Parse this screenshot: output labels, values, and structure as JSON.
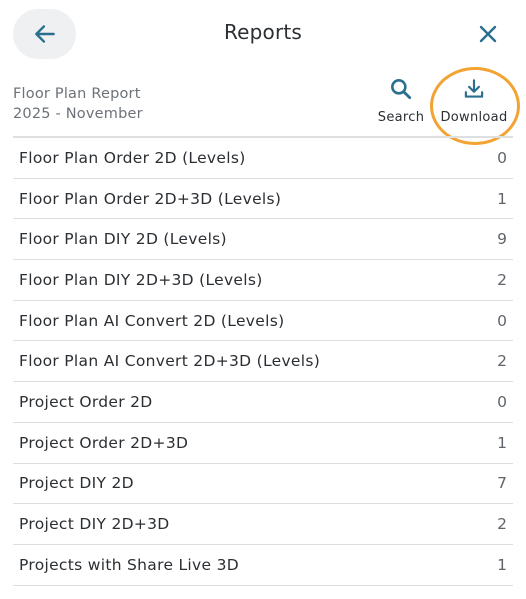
{
  "header": {
    "title": "Reports"
  },
  "report": {
    "name": "Floor Plan Report",
    "period": "2025 - November"
  },
  "actions": {
    "search_label": "Search",
    "download_label": "Download"
  },
  "rows": [
    {
      "label": "Floor Plan Order 2D (Levels)",
      "count": "0"
    },
    {
      "label": "Floor Plan Order 2D+3D (Levels)",
      "count": "1"
    },
    {
      "label": "Floor Plan DIY 2D (Levels)",
      "count": "9"
    },
    {
      "label": "Floor Plan DIY 2D+3D (Levels)",
      "count": "2"
    },
    {
      "label": "Floor Plan AI Convert 2D (Levels)",
      "count": "0"
    },
    {
      "label": "Floor Plan AI Convert 2D+3D (Levels)",
      "count": "2"
    },
    {
      "label": "Project Order 2D",
      "count": "0"
    },
    {
      "label": "Project Order 2D+3D",
      "count": "1"
    },
    {
      "label": "Project DIY 2D",
      "count": "7"
    },
    {
      "label": "Project DIY 2D+3D",
      "count": "2"
    },
    {
      "label": "Projects with Share Live 3D",
      "count": "1"
    }
  ],
  "colors": {
    "accent": "#2b6f8f",
    "highlight": "#f3a332",
    "back_button_bg": "#eef0f2"
  },
  "icons": {
    "back": "arrow-left-icon",
    "close": "close-icon",
    "search": "search-icon",
    "download": "download-icon"
  }
}
